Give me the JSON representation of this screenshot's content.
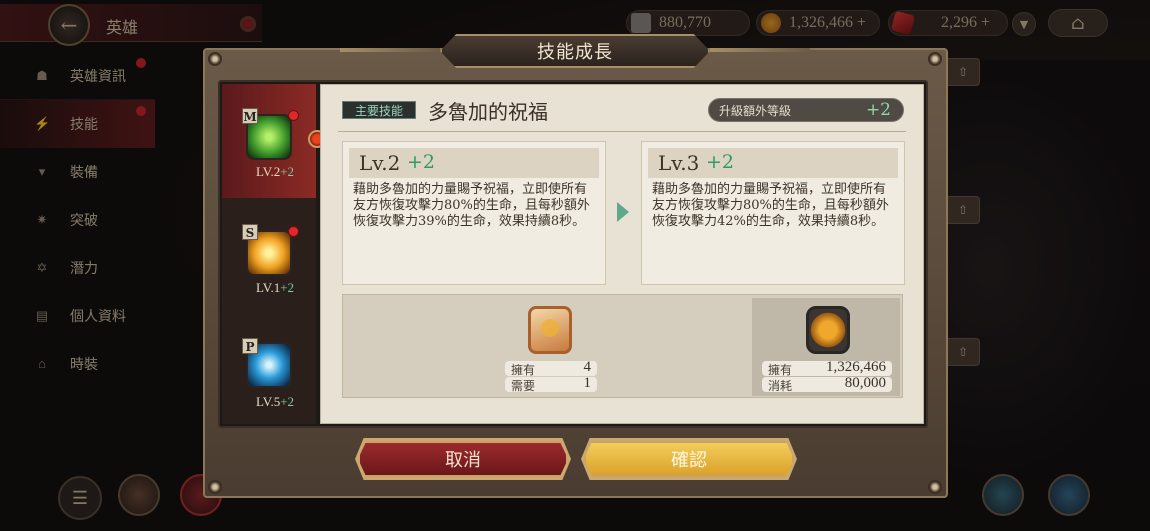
{
  "header": {
    "screen_title": "英雄",
    "resources": [
      {
        "icon": "ticket-icon",
        "value": "880,770"
      },
      {
        "icon": "gold-coin-icon",
        "value": "1,326,466",
        "plus": "+"
      },
      {
        "icon": "red-crystal-icon",
        "value": "2,296",
        "plus": "+"
      }
    ]
  },
  "sidebar": {
    "items": [
      {
        "label": "英雄資訊",
        "icon": "hero-info-icon",
        "glyph": "☗"
      },
      {
        "label": "技能",
        "icon": "lightning-icon",
        "glyph": "⚡"
      },
      {
        "label": "裝備",
        "icon": "armor-icon",
        "glyph": "▾"
      },
      {
        "label": "突破",
        "icon": "breakthrough-icon",
        "glyph": "✷"
      },
      {
        "label": "潛力",
        "icon": "potential-icon",
        "glyph": "✡"
      },
      {
        "label": "個人資料",
        "icon": "profile-icon",
        "glyph": "▤"
      },
      {
        "label": "時裝",
        "icon": "hanger-icon",
        "glyph": "⌂"
      }
    ]
  },
  "modal": {
    "title": "技能成長",
    "skills": [
      {
        "grade": "M",
        "level": "LV.2",
        "plus": "+2"
      },
      {
        "grade": "S",
        "level": "LV.1",
        "plus": "+2"
      },
      {
        "grade": "P",
        "level": "LV.5",
        "plus": "+2"
      }
    ],
    "badge": "主要技能",
    "skill_name": "多魯加的祝福",
    "extra_label": "升級額外等級",
    "extra_value": "+2",
    "current": {
      "level": "Lv.2",
      "plus": "+2",
      "desc": "藉助多魯加的力量賜予祝福，立即使所有友方恢復攻擊力80%的生命，且每秒額外恢復攻擊力39%的生命，效果持續8秒。"
    },
    "next": {
      "level": "Lv.3",
      "plus": "+2",
      "desc": "藉助多魯加的力量賜予祝福，立即使所有友方恢復攻擊力80%的生命，且每秒額外恢復攻擊力42%的生命，效果持續8秒。"
    },
    "cost_items": [
      {
        "icon": "skill-scroll-icon",
        "own_label": "擁有",
        "own_value": "4",
        "need_label": "需要",
        "need_value": "1"
      },
      {
        "icon": "gold-coin-icon",
        "own_label": "擁有",
        "own_value": "1,326,466",
        "need_label": "消耗",
        "need_value": "80,000"
      }
    ],
    "cancel_label": "取消",
    "confirm_label": "確認"
  },
  "colors": {
    "accent_green": "#2f9a68",
    "cancel_red": "#9c2a2d",
    "confirm_gold": "#f3cd5a",
    "frame_brown": "#6b5a48"
  }
}
